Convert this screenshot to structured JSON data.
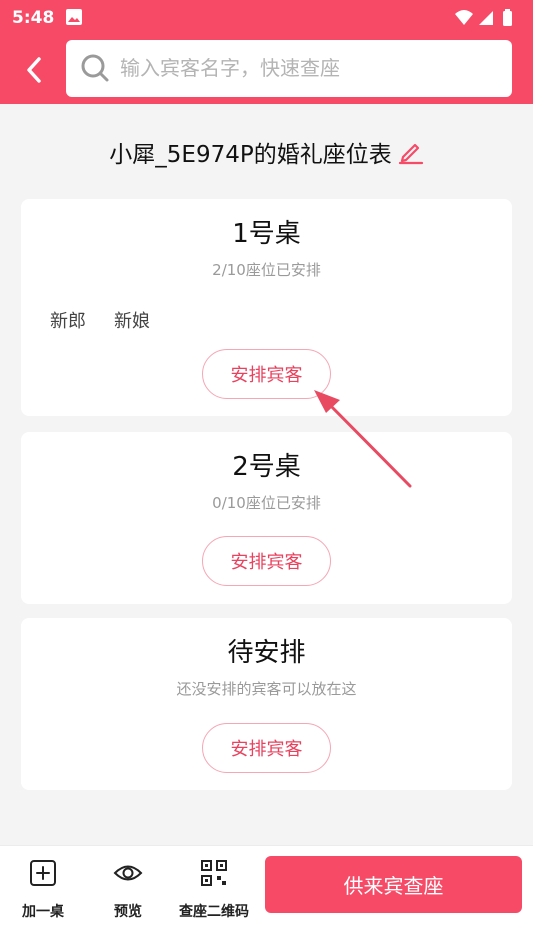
{
  "status_bar": {
    "time": "5:48"
  },
  "search": {
    "placeholder": "输入宾客名字，快速查座"
  },
  "page": {
    "title": "小犀_5E974P的婚礼座位表"
  },
  "tables": [
    {
      "name": "1号桌",
      "status": "2/10座位已安排",
      "guests": [
        "新郎",
        "新娘"
      ],
      "action_label": "安排宾客"
    },
    {
      "name": "2号桌",
      "status": "0/10座位已安排",
      "guests": [],
      "action_label": "安排宾客"
    },
    {
      "name": "待安排",
      "status": "还没安排的宾客可以放在这",
      "guests": [],
      "action_label": "安排宾客"
    }
  ],
  "bottom_bar": {
    "add_table_label": "加一桌",
    "preview_label": "预览",
    "qr_label": "查座二维码",
    "primary_label": "供来宾查座"
  },
  "colors": {
    "accent": "#f64a66",
    "button_text": "#e8425f"
  }
}
